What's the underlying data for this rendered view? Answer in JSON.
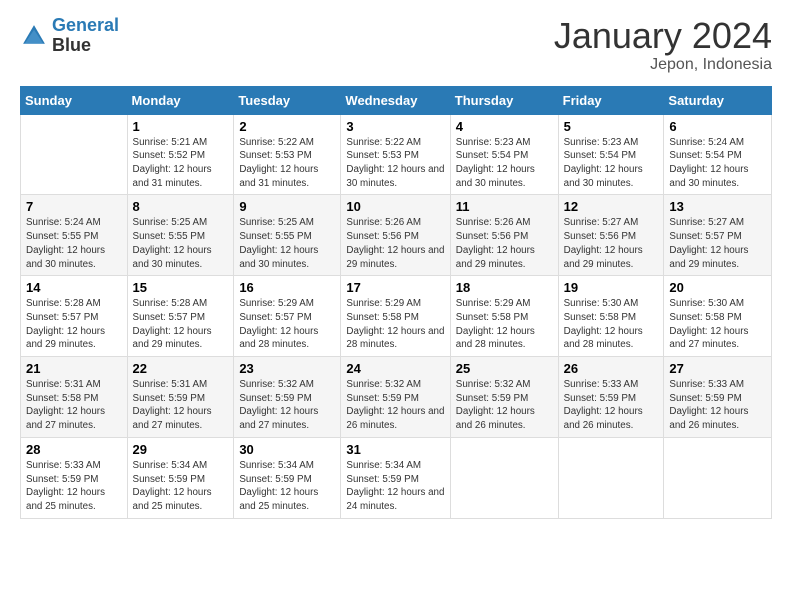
{
  "logo": {
    "line1": "General",
    "line2": "Blue"
  },
  "title": "January 2024",
  "subtitle": "Jepon, Indonesia",
  "headers": [
    "Sunday",
    "Monday",
    "Tuesday",
    "Wednesday",
    "Thursday",
    "Friday",
    "Saturday"
  ],
  "weeks": [
    [
      {
        "day": "",
        "sunrise": "",
        "sunset": "",
        "daylight": ""
      },
      {
        "day": "1",
        "sunrise": "5:21 AM",
        "sunset": "5:52 PM",
        "daylight": "12 hours and 31 minutes."
      },
      {
        "day": "2",
        "sunrise": "5:22 AM",
        "sunset": "5:53 PM",
        "daylight": "12 hours and 31 minutes."
      },
      {
        "day": "3",
        "sunrise": "5:22 AM",
        "sunset": "5:53 PM",
        "daylight": "12 hours and 30 minutes."
      },
      {
        "day": "4",
        "sunrise": "5:23 AM",
        "sunset": "5:54 PM",
        "daylight": "12 hours and 30 minutes."
      },
      {
        "day": "5",
        "sunrise": "5:23 AM",
        "sunset": "5:54 PM",
        "daylight": "12 hours and 30 minutes."
      },
      {
        "day": "6",
        "sunrise": "5:24 AM",
        "sunset": "5:54 PM",
        "daylight": "12 hours and 30 minutes."
      }
    ],
    [
      {
        "day": "7",
        "sunrise": "5:24 AM",
        "sunset": "5:55 PM",
        "daylight": "12 hours and 30 minutes."
      },
      {
        "day": "8",
        "sunrise": "5:25 AM",
        "sunset": "5:55 PM",
        "daylight": "12 hours and 30 minutes."
      },
      {
        "day": "9",
        "sunrise": "5:25 AM",
        "sunset": "5:55 PM",
        "daylight": "12 hours and 30 minutes."
      },
      {
        "day": "10",
        "sunrise": "5:26 AM",
        "sunset": "5:56 PM",
        "daylight": "12 hours and 29 minutes."
      },
      {
        "day": "11",
        "sunrise": "5:26 AM",
        "sunset": "5:56 PM",
        "daylight": "12 hours and 29 minutes."
      },
      {
        "day": "12",
        "sunrise": "5:27 AM",
        "sunset": "5:56 PM",
        "daylight": "12 hours and 29 minutes."
      },
      {
        "day": "13",
        "sunrise": "5:27 AM",
        "sunset": "5:57 PM",
        "daylight": "12 hours and 29 minutes."
      }
    ],
    [
      {
        "day": "14",
        "sunrise": "5:28 AM",
        "sunset": "5:57 PM",
        "daylight": "12 hours and 29 minutes."
      },
      {
        "day": "15",
        "sunrise": "5:28 AM",
        "sunset": "5:57 PM",
        "daylight": "12 hours and 29 minutes."
      },
      {
        "day": "16",
        "sunrise": "5:29 AM",
        "sunset": "5:57 PM",
        "daylight": "12 hours and 28 minutes."
      },
      {
        "day": "17",
        "sunrise": "5:29 AM",
        "sunset": "5:58 PM",
        "daylight": "12 hours and 28 minutes."
      },
      {
        "day": "18",
        "sunrise": "5:29 AM",
        "sunset": "5:58 PM",
        "daylight": "12 hours and 28 minutes."
      },
      {
        "day": "19",
        "sunrise": "5:30 AM",
        "sunset": "5:58 PM",
        "daylight": "12 hours and 28 minutes."
      },
      {
        "day": "20",
        "sunrise": "5:30 AM",
        "sunset": "5:58 PM",
        "daylight": "12 hours and 27 minutes."
      }
    ],
    [
      {
        "day": "21",
        "sunrise": "5:31 AM",
        "sunset": "5:58 PM",
        "daylight": "12 hours and 27 minutes."
      },
      {
        "day": "22",
        "sunrise": "5:31 AM",
        "sunset": "5:59 PM",
        "daylight": "12 hours and 27 minutes."
      },
      {
        "day": "23",
        "sunrise": "5:32 AM",
        "sunset": "5:59 PM",
        "daylight": "12 hours and 27 minutes."
      },
      {
        "day": "24",
        "sunrise": "5:32 AM",
        "sunset": "5:59 PM",
        "daylight": "12 hours and 26 minutes."
      },
      {
        "day": "25",
        "sunrise": "5:32 AM",
        "sunset": "5:59 PM",
        "daylight": "12 hours and 26 minutes."
      },
      {
        "day": "26",
        "sunrise": "5:33 AM",
        "sunset": "5:59 PM",
        "daylight": "12 hours and 26 minutes."
      },
      {
        "day": "27",
        "sunrise": "5:33 AM",
        "sunset": "5:59 PM",
        "daylight": "12 hours and 26 minutes."
      }
    ],
    [
      {
        "day": "28",
        "sunrise": "5:33 AM",
        "sunset": "5:59 PM",
        "daylight": "12 hours and 25 minutes."
      },
      {
        "day": "29",
        "sunrise": "5:34 AM",
        "sunset": "5:59 PM",
        "daylight": "12 hours and 25 minutes."
      },
      {
        "day": "30",
        "sunrise": "5:34 AM",
        "sunset": "5:59 PM",
        "daylight": "12 hours and 25 minutes."
      },
      {
        "day": "31",
        "sunrise": "5:34 AM",
        "sunset": "5:59 PM",
        "daylight": "12 hours and 24 minutes."
      },
      {
        "day": "",
        "sunrise": "",
        "sunset": "",
        "daylight": ""
      },
      {
        "day": "",
        "sunrise": "",
        "sunset": "",
        "daylight": ""
      },
      {
        "day": "",
        "sunrise": "",
        "sunset": "",
        "daylight": ""
      }
    ]
  ]
}
